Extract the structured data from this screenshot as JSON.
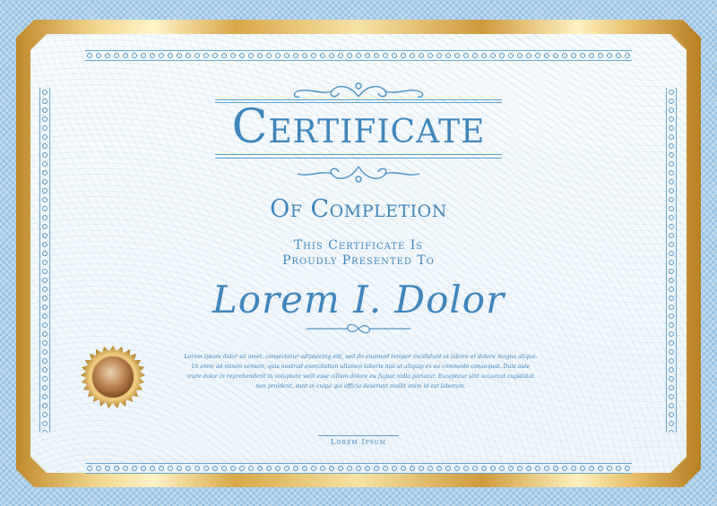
{
  "certificate": {
    "title": "Certificate",
    "subtitle": "Of Completion",
    "presented_line1": "This Certificate Is",
    "presented_line2": "Proudly Presented To",
    "recipient_name": "Lorem I. Dolor",
    "body_text": "Lorem ipsum dolor sit amet, consectetur adipisicing elit, sed do eiusmod tempor incididunt ut labore et dolore magna aliqua. Ut enim ad minim veniam, quis nostrud exercitation ullamco laboris nisi ut aliquip ex ea commodo consequat. Duis aute irure dolor in reprehenderit in voluptate velit esse cillum dolore eu fugiat nulla pariatur. Excepteur sint occaecat cupidatat non proident, sunt in culpa qui officia deserunt mollit anim id est laborum.",
    "signer": "Lorem Ipsum"
  },
  "colors": {
    "ink_blue": "#3f86bd",
    "gold": "#d8a748",
    "seal_bronze": "#a8703a"
  },
  "icons": {
    "seal": "medal-seal-icon",
    "top_flourish": "scroll-flourish-icon",
    "divider_flourish": "ornament-divider-icon"
  }
}
